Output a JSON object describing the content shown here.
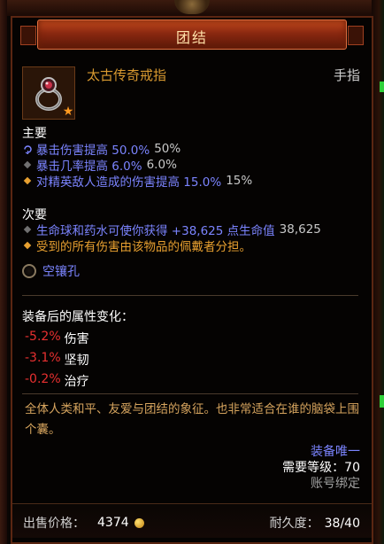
{
  "tooltip": {
    "title": "团结",
    "item_name": "太古传奇戒指",
    "item_slot": "手指",
    "primary_label": "主要",
    "primary": [
      {
        "text": "暴击伤害提高 50.0%",
        "extra": "50%",
        "bullet": "refresh-icon"
      },
      {
        "text": "暴击几率提高 6.0%",
        "extra": "6.0%",
        "bullet": "diamond-icon"
      },
      {
        "text": "对精英敌人造成的伤害提高 15.0%",
        "extra": "15%",
        "bullet": "diamond-icon"
      }
    ],
    "secondary_label": "次要",
    "secondary": [
      {
        "text": "生命球和药水可使你获得 +38,625 点生命值",
        "extra": "38,625",
        "bullet": "diamond-icon"
      },
      {
        "text": "受到的所有伤害由该物品的佩戴者分担。",
        "bullet": "diamond-icon"
      }
    ],
    "socket_label": "空镶孔",
    "stat_change_title": "装备后的属性变化：",
    "stat_changes": [
      {
        "delta": "-5.2%",
        "label": "伤害"
      },
      {
        "delta": "-3.1%",
        "label": "坚韧"
      },
      {
        "delta": "-0.2%",
        "label": "治疗"
      }
    ],
    "flavor_text": "全体人类和平、友爱与团结的象征。也非常适合在谁的脑袋上围个囊。",
    "unique_equipped": "装备唯一",
    "required_level": "需要等级：70",
    "account_bound": "账号绑定",
    "sell_price_label": "出售价格：",
    "sell_price_value": "4374",
    "durability_label": "耐久度：",
    "durability_value": "38/40"
  },
  "colors": {
    "magic_blue": "#7b84ff",
    "legendary_orange": "#d99a30",
    "negative_red": "#e83030"
  }
}
